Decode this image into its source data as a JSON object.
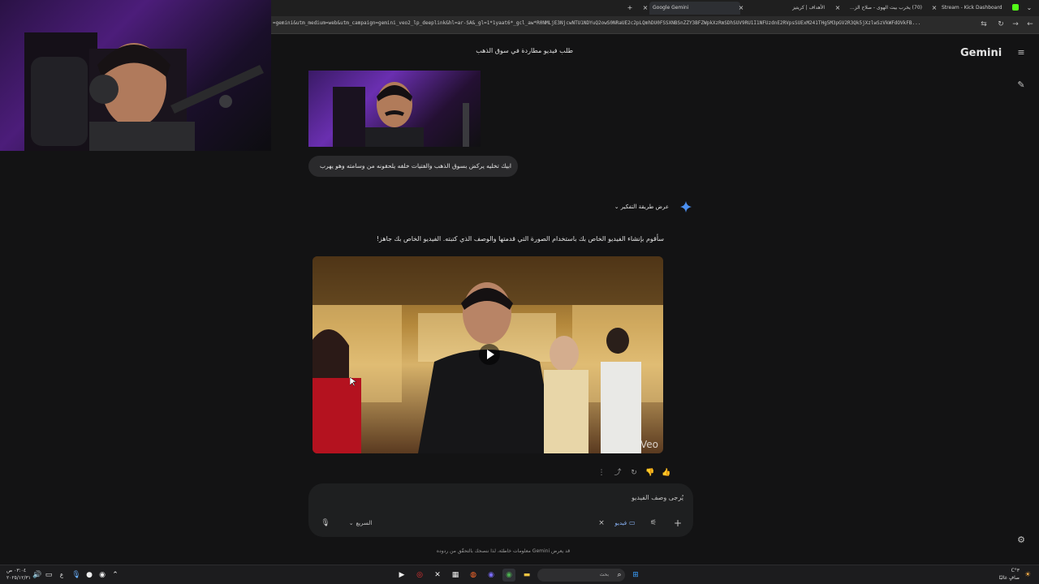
{
  "browser": {
    "tabs": [
      {
        "label": "Stream - Kick Dashboard",
        "active": false
      },
      {
        "label": "(70) يخرب بيت الهوى - صلاح الز...",
        "active": false
      },
      {
        "label": "الأهداف | كريتيز",
        "active": false
      },
      {
        "label": "Google Gemini",
        "active": true
      }
    ],
    "url": "=gemini&utm_medium=web&utm_campaign=gemini_veo2_lp_deeplink&hl=ar-SA&_gl=1*1yaat6*_gcl_aw*R0NMLjE3NjcwNTU1NDYuQ2owS0NRaUE2c2pLQmhDU0FSSXNBSnZZY3BFZWpkXzRmSDhSUV9RU1I1NFUzdnE2RVpsSUExM241THg5M3pGV2R3Qk5jXzlwSzVkWFdOVkFB..."
  },
  "gemini": {
    "brand": "Gemini",
    "chat_title": "طلب فيديو مطاردة في سوق الذهب",
    "user_prompt": "ابيك تخليه يركض بسوق الذهب والفتيات خلفه يلحقونه من وسامته وهو يهرب",
    "thinking_toggle": "عرض طريقة التفكير",
    "reply": "سأقوم بإنشاء الفيديو الخاص بك باستخدام الصورة التي قدمتها والوصف الذي كتبته. الفيديو الخاص بك جاهز!",
    "video_watermark": "Veo",
    "composer": {
      "placeholder": "يُرجى وصف الفيديو",
      "model_label": "السريع",
      "tool_chip": "فيديو"
    },
    "disclaimer": "قد يعرض Gemini معلومات خاطئة، لذا ننصحك بالتحقّق من ردوده"
  },
  "taskbar": {
    "search_placeholder": "بحث",
    "clock_time": "٠٣:٠٤ ص",
    "clock_date": "٢٠٢٥/١٢/٣١",
    "weather_temp": "٣°C",
    "weather_desc": "صافٍ غالبًا",
    "lang": "ع"
  },
  "colors": {
    "page_bg": "#131314",
    "composer_bg": "#1e1f20",
    "gemini_spark": "#4b8ff0",
    "text": "#e3e3e3"
  }
}
